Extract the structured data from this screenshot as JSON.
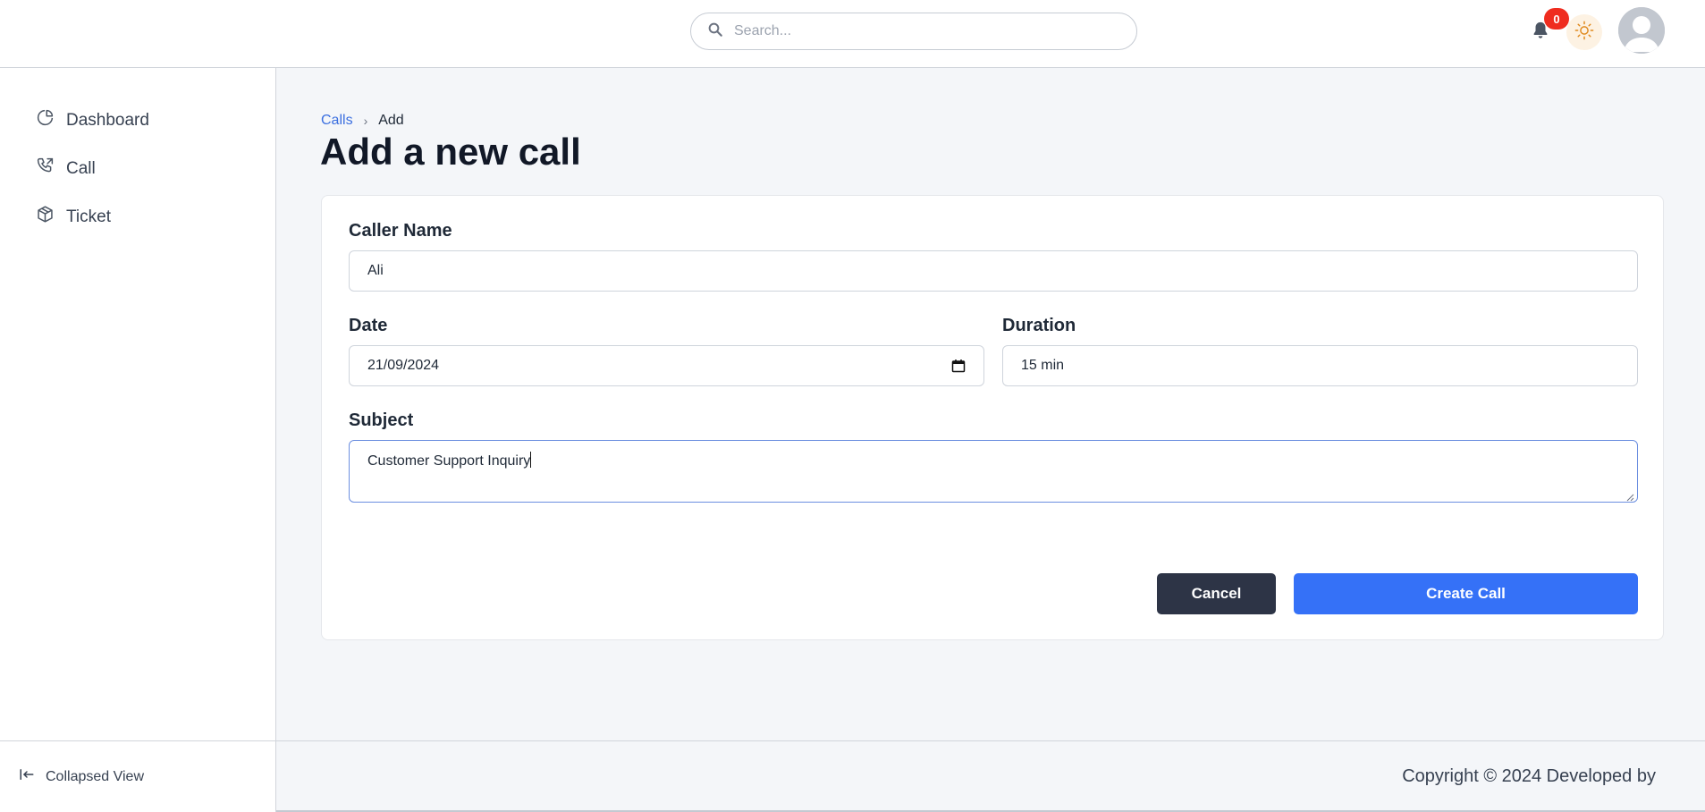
{
  "header": {
    "search_placeholder": "Search...",
    "notification_count": "0",
    "icons": [
      "search-icon",
      "bell-icon",
      "sun-icon",
      "avatar-icon"
    ]
  },
  "sidebar": {
    "items": [
      {
        "label": "Dashboard",
        "icon": "pie-chart-icon"
      },
      {
        "label": "Call",
        "icon": "phone-icon"
      },
      {
        "label": "Ticket",
        "icon": "box-icon"
      }
    ],
    "collapse_label": "Collapsed View"
  },
  "breadcrumb": {
    "parent": "Calls",
    "current": "Add"
  },
  "page": {
    "title": "Add a new call"
  },
  "form": {
    "caller_name_label": "Caller Name",
    "caller_name_value": "Ali",
    "date_label": "Date",
    "date_value": "21/09/2024",
    "duration_label": "Duration",
    "duration_value": "15 min",
    "subject_label": "Subject",
    "subject_value": "Customer Support Inquiry",
    "cancel_label": "Cancel",
    "submit_label": "Create Call"
  },
  "footer": {
    "copyright": "Copyright © 2024 Developed by"
  },
  "colors": {
    "primary": "#3571f7",
    "dark_button": "#2d3446",
    "badge": "#ef2c1f",
    "link": "#3b6fe0"
  }
}
